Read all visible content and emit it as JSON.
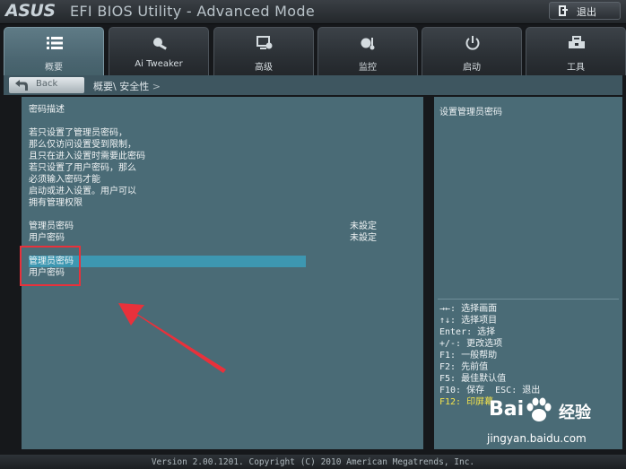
{
  "header": {
    "brand": "ASUS",
    "title": "EFI BIOS Utility - Advanced Mode",
    "exit_label": "退出"
  },
  "tabs": [
    {
      "label": "概要",
      "icon": "list-icon",
      "active": true
    },
    {
      "label": "Ai Tweaker",
      "icon": "tweaker-icon",
      "active": false
    },
    {
      "label": "高级",
      "icon": "advanced-icon",
      "active": false
    },
    {
      "label": "监控",
      "icon": "monitor-icon",
      "active": false
    },
    {
      "label": "启动",
      "icon": "power-icon",
      "active": false
    },
    {
      "label": "工具",
      "icon": "tool-icon",
      "active": false
    }
  ],
  "breadcrumb": {
    "back_label": "Back",
    "path": [
      "概要\\",
      "安全性",
      ">"
    ]
  },
  "main": {
    "desc_title": "密码描述",
    "desc_lines": [
      "若只设置了管理员密码，",
      "那么仅访问设置受到限制，",
      "且只在进入设置时需要此密码",
      "若只设置了用户密码，那么",
      "必须输入密码才能",
      "启动或进入设置。用户可以",
      "拥有管理权限"
    ],
    "status": [
      {
        "label": "管理员密码",
        "value": "未設定"
      },
      {
        "label": "用户密码",
        "value": "未設定"
      }
    ],
    "options": [
      {
        "label": "管理员密码",
        "selected": true
      },
      {
        "label": "用户密码",
        "selected": false
      }
    ]
  },
  "help": {
    "description": "设置管理员密码",
    "keys": [
      {
        "text": "→←: 选择画面"
      },
      {
        "text": "↑↓: 选择项目"
      },
      {
        "text": "Enter: 选择"
      },
      {
        "text": "+/-: 更改选项"
      },
      {
        "text": "F1: 一般帮助"
      },
      {
        "text": "F2: 先前值"
      },
      {
        "text": "F5: 最佳默认值"
      },
      {
        "text": "F10: 保存  ESC: 退出"
      },
      {
        "text": "F12: 印屏幕",
        "highlight": true
      }
    ]
  },
  "footer": {
    "version": "Version 2.00.1201. Copyright (C) 2010 American Megatrends, Inc."
  },
  "watermark": {
    "brand_left": "Bai",
    "brand_right": "经验",
    "url": "jingyan.baidu.com"
  },
  "colors": {
    "panel": "#4a6b76",
    "highlight": "#3d97b1",
    "annotation_red": "#e8313b",
    "key_highlight": "#f5e44b"
  }
}
